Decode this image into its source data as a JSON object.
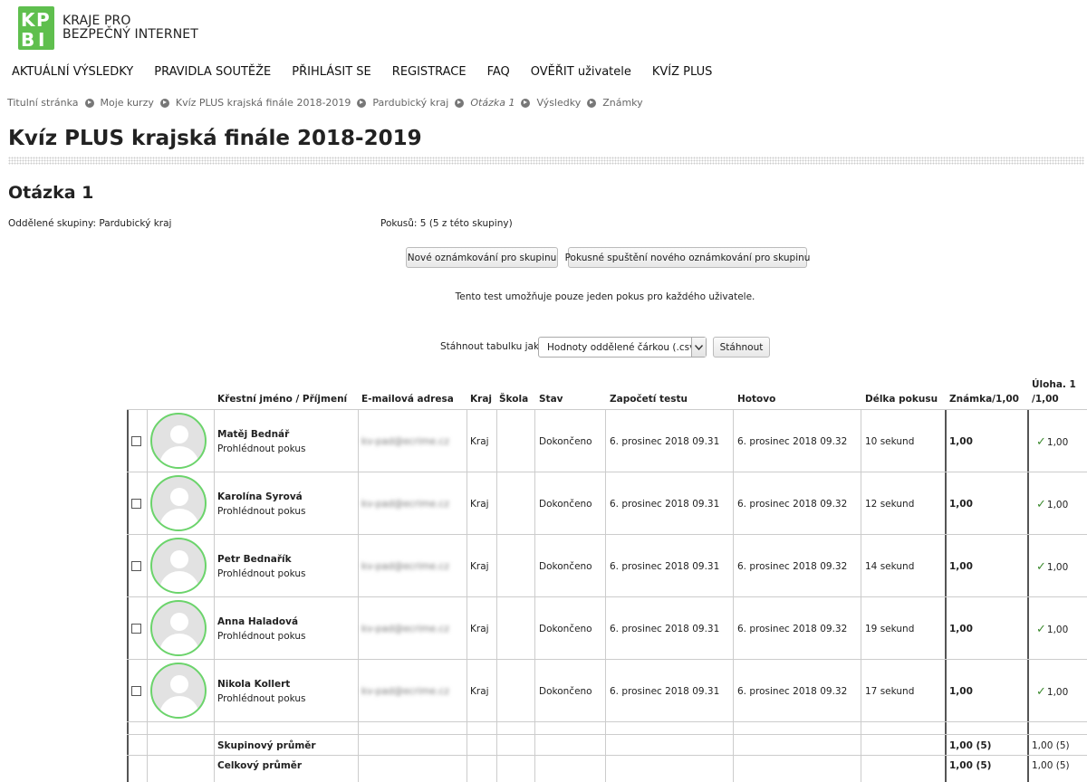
{
  "logo": {
    "letters": "KPBI",
    "line1": "KRAJE PRO",
    "line2": "BEZPEČNÝ INTERNET"
  },
  "nav": [
    "AKTUÁLNÍ VÝSLEDKY",
    "PRAVIDLA SOUTĚŽE",
    "PŘIHLÁSIT SE",
    "REGISTRACE",
    "FAQ",
    "OVĚŘIT uživatele",
    "KVÍZ PLUS"
  ],
  "breadcrumb": [
    "Titulní stránka",
    "Moje kurzy",
    "Kvíz PLUS krajská finále 2018-2019",
    "Pardubický kraj",
    "Otázka 1",
    "Výsledky",
    "Známky"
  ],
  "page_title": "Kvíz PLUS krajská finále 2018-2019",
  "section_title": "Otázka 1",
  "groups_text": "Oddělené skupiny: Pardubický kraj",
  "attempts_text": "Pokusů: 5 (5 z této skupiny)",
  "buttons": {
    "regrade": "Nové oznámkování pro skupinu",
    "dry_run": "Pokusné spuštění nového oznámkování pro skupinu",
    "download": "Stáhnout"
  },
  "info_text": "Tento test umožňuje pouze jeden pokus pro každého uživatele.",
  "download_label": "Stáhnout tabulku jako",
  "download_format": "Hodnoty oddělené čárkou (.csv)",
  "columns": {
    "name": "Křestní jméno / Příjmení",
    "email": "E-mailová adresa",
    "region": "Kraj",
    "school": "Škola",
    "state": "Stav",
    "started": "Započetí testu",
    "finished": "Hotovo",
    "duration": "Délka pokusu",
    "grade": "Známka/1,00",
    "q1_line1": "Úloha. 1",
    "q1_line2": "/1,00"
  },
  "rows": [
    {
      "name": "Matěj Bednář",
      "review": "Prohlédnout pokus",
      "email": "kv-pad@ecrime.cz",
      "region": "Kraj",
      "school": "",
      "state": "Dokončeno",
      "started": "6. prosinec 2018 09.31",
      "finished": "6. prosinec 2018 09.32",
      "duration": "10 sekund",
      "grade": "1,00",
      "q1": "1,00"
    },
    {
      "name": "Karolína Syrová",
      "review": "Prohlédnout pokus",
      "email": "kv-pad@ecrime.cz",
      "region": "Kraj",
      "school": "",
      "state": "Dokončeno",
      "started": "6. prosinec 2018 09.31",
      "finished": "6. prosinec 2018 09.32",
      "duration": "12 sekund",
      "grade": "1,00",
      "q1": "1,00"
    },
    {
      "name": "Petr Bednařík",
      "review": "Prohlédnout pokus",
      "email": "kv-pad@ecrime.cz",
      "region": "Kraj",
      "school": "",
      "state": "Dokončeno",
      "started": "6. prosinec 2018 09.31",
      "finished": "6. prosinec 2018 09.32",
      "duration": "14 sekund",
      "grade": "1,00",
      "q1": "1,00"
    },
    {
      "name": "Anna Haladová",
      "review": "Prohlédnout pokus",
      "email": "kv-pad@ecrime.cz",
      "region": "Kraj",
      "school": "",
      "state": "Dokončeno",
      "started": "6. prosinec 2018 09.31",
      "finished": "6. prosinec 2018 09.32",
      "duration": "19 sekund",
      "grade": "1,00",
      "q1": "1,00"
    },
    {
      "name": "Nikola Kollert",
      "review": "Prohlédnout pokus",
      "email": "kv-pad@ecrime.cz",
      "region": "Kraj",
      "school": "",
      "state": "Dokončeno",
      "started": "6. prosinec 2018 09.31",
      "finished": "6. prosinec 2018 09.32",
      "duration": "17 sekund",
      "grade": "1,00",
      "q1": "1,00"
    }
  ],
  "summary": [
    {
      "label": "Skupinový průměr",
      "grade": "1,00 (5)",
      "q1": "1,00 (5)"
    },
    {
      "label": "Celkový průměr",
      "grade": "1,00 (5)",
      "q1": "1,00 (5)"
    }
  ],
  "colors": {
    "accent_green": "#5cb85c",
    "logo_green": "#5fbf4e",
    "check_green": "#3c8a2e"
  }
}
